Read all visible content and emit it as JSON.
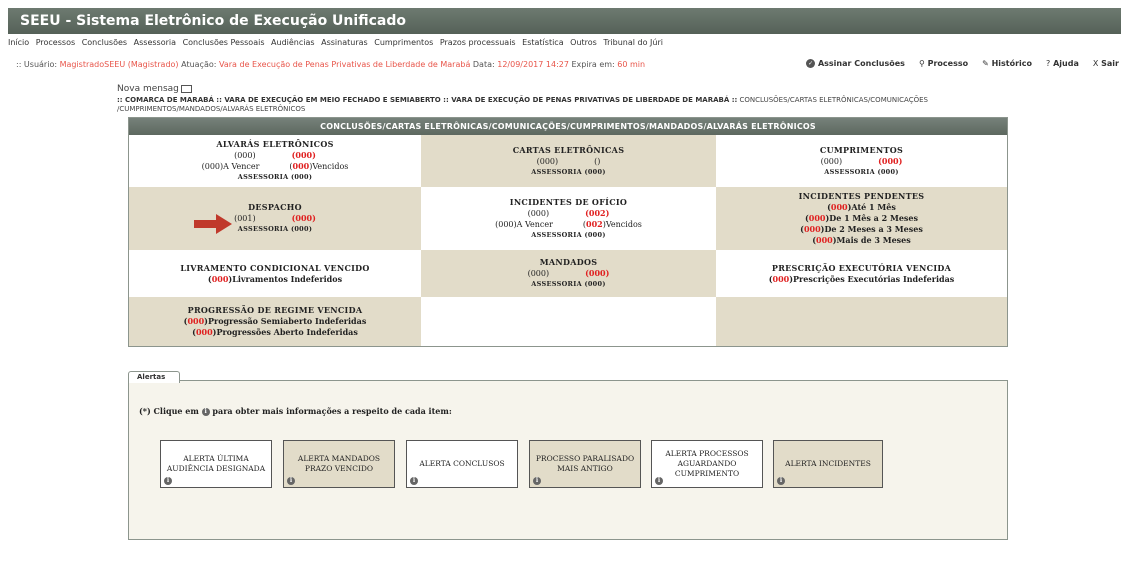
{
  "app": {
    "title": "SEEU - Sistema Eletrônico de Execução Unificado"
  },
  "menu": [
    "Início",
    "Processos",
    "Conclusões",
    "Assessoria",
    "Conclusões Pessoais",
    "Audiências",
    "Assinaturas",
    "Cumprimentos",
    "Prazos processuais",
    "Estatística",
    "Outros",
    "Tribunal do Júri"
  ],
  "user": {
    "prefix": ":: Usuário:",
    "name": "MagistradoSEEU (Magistrado)",
    "atuacao_label": "Atuação:",
    "atuacao": "Vara de Execução de Penas Privativas de Liberdade de Marabá",
    "data_label": "Data:",
    "data": "12/09/2017 14:27",
    "expira_label": "Expira em:",
    "expira": "60 min"
  },
  "toolbar": {
    "assinar": "Assinar Conclusões",
    "processo": "Processo",
    "historico": "Histórico",
    "ajuda": "Ajuda",
    "sair": "Sair"
  },
  "nova_mensagem": "Nova mensag",
  "breadcrumb": {
    "part1": ":: COMARCA DE MARABÁ :: VARA DE EXECUÇÃO EM MEIO FECHADO E SEMIABERTO :: VARA DE EXECUÇÃO DE PENAS PRIVATIVAS DE LIBERDADE DE MARABÁ ::",
    "part2": "CONCLUSÕES/CARTAS ELETRÔNICAS/COMUNICAÇÕES /CUMPRIMENTOS/MANDADOS/ALVARÁS ELETRÔNICOS"
  },
  "panel": {
    "header": "CONCLUSÕES/CARTAS ELETRÔNICAS/COMUNICAÇÕES/CUMPRIMENTOS/MANDADOS/ALVARÁS ELETRÔNICOS",
    "alvaras": {
      "title": "ALVARÁS ELETRÔNICOS",
      "a": "(000)",
      "b": "(000)",
      "c_pre": "(000)A Vencer",
      "d_num": "000",
      "d_label": "Vencidos",
      "assess": "ASSESSORIA (000)"
    },
    "cartas": {
      "title": "CARTAS ELETRÔNICAS",
      "a": "(000)",
      "b": "()",
      "assess": "ASSESSORIA (000)"
    },
    "cumprimentos": {
      "title": "CUMPRIMENTOS",
      "a": "(000)",
      "b": "(000)",
      "assess": "ASSESSORIA (000)"
    },
    "despacho": {
      "title": "DESPACHO",
      "a": "(001)",
      "b": "(000)",
      "assess": "ASSESSORIA (000)"
    },
    "incidentes_oficio": {
      "title": "INCIDENTES DE OFÍCIO",
      "a": "(000)",
      "b": "(002)",
      "c_pre": "(000)A Vencer",
      "d_num": "002",
      "d_label": "Vencidos",
      "assess": "ASSESSORIA (000)"
    },
    "incidentes_pendentes": {
      "title": "INCIDENTES PENDENTES",
      "l1n": "000",
      "l1": "Até 1 Mês",
      "l2n": "000",
      "l2": "De 1 Mês a 2 Meses",
      "l3n": "000",
      "l3": "De 2 Meses a 3 Meses",
      "l4n": "000",
      "l4": "Mais de 3 Meses"
    },
    "livramento": {
      "title": "LIVRAMENTO CONDICIONAL VENCIDO",
      "n": "000",
      "label": "Livramentos Indeferidos"
    },
    "mandados": {
      "title": "MANDADOS",
      "a": "(000)",
      "b": "(000)",
      "assess": "ASSESSORIA (000)"
    },
    "prescricao": {
      "title": "PRESCRIÇÃO EXECUTÓRIA VENCIDA",
      "n": "000",
      "label": "Prescrições Executórias Indeferidas"
    },
    "progressao": {
      "title": "PROGRESSÃO DE REGIME VENCIDA",
      "n1": "000",
      "l1": "Progressão Semiaberto Indeferidas",
      "n2": "000",
      "l2": "Progressões Aberto Indeferidas"
    }
  },
  "alerts": {
    "tab": "Alertas",
    "hint_pre": "(*) Clique em",
    "hint_post": "para obter mais informações a respeito de cada item:",
    "info_glyph": "i",
    "items": [
      "ALERTA ÚLTIMA AUDIÊNCIA DESIGNADA",
      "ALERTA MANDADOS PRAZO VENCIDO",
      "ALERTA CONCLUSOS",
      "PROCESSO PARALISADO MAIS ANTIGO",
      "ALERTA PROCESSOS AGUARDANDO CUMPRIMENTO",
      "ALERTA INCIDENTES"
    ]
  },
  "colors": {
    "accent_red": "#e02020",
    "header_green": "#5d685f",
    "tan": "#e2dcc9",
    "arrow": "#c0392b"
  }
}
